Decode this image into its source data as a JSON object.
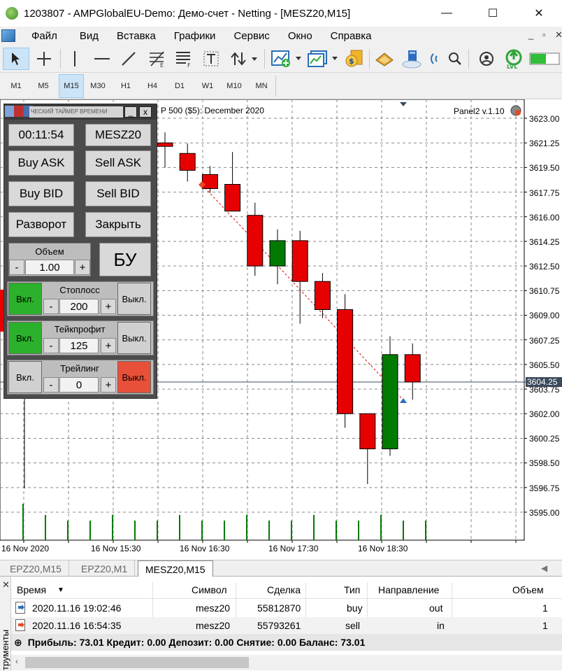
{
  "window": {
    "title": "1203807 - AMPGlobalEU-Demo: Демо-счет - Netting - [MESZ20,M15]",
    "minimize": "—",
    "maximize": "☐",
    "close": "✕"
  },
  "menu": {
    "items": [
      "Файл",
      "Вид",
      "Вставка",
      "Графики",
      "Сервис",
      "Окно",
      "Справка"
    ],
    "mdi_min": "_",
    "mdi_restore": "▫",
    "mdi_close": "✕"
  },
  "toolbar": {
    "icons": [
      "cursor-icon",
      "crosshair-icon",
      "vertical-line-icon",
      "horizontal-line-icon",
      "trendline-icon",
      "fibonacci-icon",
      "channels-icon",
      "text-icon",
      "arrows-icon",
      "new-chart-icon",
      "templates-icon",
      "symbols-icon",
      "market-icon",
      "vps-icon",
      "signal-icon",
      "search-icon",
      "account-icon",
      "lvl-icon",
      "battery-icon"
    ]
  },
  "timeframes": {
    "items": [
      "M1",
      "M5",
      "M15",
      "M30",
      "H1",
      "H4",
      "D1",
      "W1",
      "M10",
      "MN"
    ],
    "active": "M15"
  },
  "chart": {
    "symbol_label": "P 500 ($5): December 2020",
    "panel_version": "Panel2 v.1.10",
    "current_price": "3604.25",
    "price_labels": [
      "3623.00",
      "3621.25",
      "3619.50",
      "3617.75",
      "3616.00",
      "3614.25",
      "3612.50",
      "3610.75",
      "3609.00",
      "3607.25",
      "3605.50",
      "3603.75",
      "3602.00",
      "3600.25",
      "3598.50",
      "3596.75",
      "3595.00"
    ],
    "time_labels": [
      "16 Nov 2020",
      "16 Nov 15:30",
      "16 Nov 16:30",
      "16 Nov 17:30",
      "16 Nov 18:30"
    ],
    "colors": {
      "bull": "#007a00",
      "bear": "#e60000",
      "grid": "#8a8a8a"
    }
  },
  "chart_data": {
    "type": "candlestick",
    "ylim": [
      3594,
      3624
    ],
    "candles": [
      {
        "o": 3621.25,
        "h": 3622.0,
        "l": 3619.5,
        "c": 3621.0,
        "bear": true
      },
      {
        "o": 3620.5,
        "h": 3621.2,
        "l": 3618.5,
        "c": 3619.3,
        "bear": true
      },
      {
        "o": 3619.0,
        "h": 3619.6,
        "l": 3617.7,
        "c": 3618.0,
        "bear": true
      },
      {
        "o": 3618.3,
        "h": 3620.6,
        "l": 3617.0,
        "c": 3616.4,
        "bear": true
      },
      {
        "o": 3616.1,
        "h": 3617.0,
        "l": 3611.8,
        "c": 3612.5,
        "bear": true
      },
      {
        "o": 3612.5,
        "h": 3615.1,
        "l": 3611.2,
        "c": 3614.3,
        "bear": false
      },
      {
        "o": 3614.3,
        "h": 3615.0,
        "l": 3608.4,
        "c": 3611.4,
        "bear": true
      },
      {
        "o": 3611.4,
        "h": 3612.0,
        "l": 3608.8,
        "c": 3609.4,
        "bear": true
      },
      {
        "o": 3609.4,
        "h": 3610.5,
        "l": 3601.0,
        "c": 3602.0,
        "bear": true
      },
      {
        "o": 3602.0,
        "h": 3602.0,
        "l": 3597.0,
        "c": 3599.5,
        "bear": true
      },
      {
        "o": 3599.5,
        "h": 3607.5,
        "l": 3599.0,
        "c": 3606.2,
        "bear": false
      },
      {
        "o": 3606.2,
        "h": 3607.0,
        "l": 3603.0,
        "c": 3604.25,
        "bear": true
      }
    ],
    "volume_bars": 19
  },
  "panel": {
    "title": "ЧЕСКИЙ ТАЙМЕР ВРЕМЕНИ",
    "min": "_",
    "close": "x",
    "timer": "00:11:54",
    "symbol": "MESZ20",
    "buy_ask": "Buy ASK",
    "sell_ask": "Sell ASK",
    "buy_bid": "Buy BID",
    "sell_bid": "Sell BID",
    "reverse": "Разворот",
    "close_pos": "Закрыть",
    "volume_label": "Объем",
    "volume": "1.00",
    "breakeven": "БУ",
    "minus": "-",
    "plus": "+",
    "on": "Вкл.",
    "off": "Выкл.",
    "stoploss_label": "Стоплосс",
    "stoploss": "200",
    "takeprofit_label": "Тейкпрофит",
    "takeprofit": "125",
    "trailing_label": "Трейлинг",
    "trailing": "0"
  },
  "tabs": {
    "items": [
      "EPZ20,M15",
      "EPZ20,M1",
      "MESZ20,M15"
    ],
    "active": "MESZ20,M15"
  },
  "toolbox": {
    "side_label": "трументы",
    "columns": [
      "Время",
      "Символ",
      "Сделка",
      "Тип",
      "Направление",
      "Объем"
    ],
    "rows": [
      {
        "time": "2020.11.16 19:02:46",
        "symbol": "mesz20",
        "deal": "55812870",
        "type": "buy",
        "direction": "out",
        "volume": "1"
      },
      {
        "time": "2020.11.16 16:54:35",
        "symbol": "mesz20",
        "deal": "55793261",
        "type": "sell",
        "direction": "in",
        "volume": "1"
      }
    ],
    "summary": "Прибыль: 73.01  Кредит: 0.00  Депозит: 0.00  Снятие: 0.00  Баланс: 73.01"
  }
}
